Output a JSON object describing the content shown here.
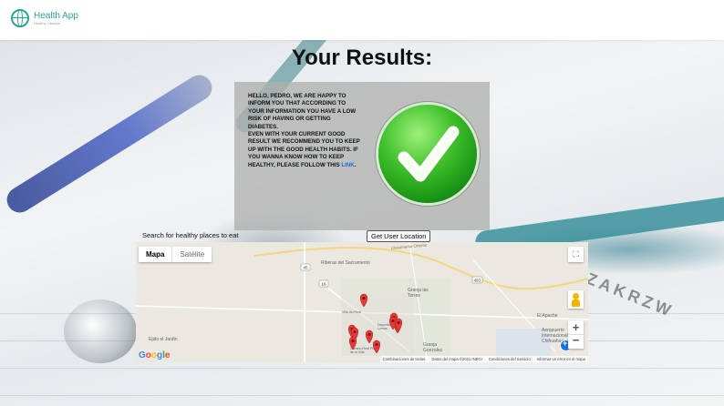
{
  "header": {
    "app_name": "Health App",
    "tagline": "Healthy Lifestyle"
  },
  "page": {
    "title": "Your Results:"
  },
  "result": {
    "message": "Hello, Pedro, we are happy to inform you that according to your information you have a low risk of having or getting diabetes.",
    "advice_prefix": "Even with your current good result we recommend you to keep up with the good health habits. If you wanna know how to keep healthy, please follow this",
    "link_text": "link",
    "advice_suffix": ".",
    "status_icon": "green-check-icon"
  },
  "search": {
    "label": "Search for healthy places to eat",
    "location_button": "Get User Location"
  },
  "map": {
    "type_options": [
      "Mapa",
      "Satélite"
    ],
    "selected_type": "Mapa",
    "places": [
      "Riberas del Sacramento",
      "Granja las Torres",
      "Ejido el Jardín",
      "Granja Gonzalez",
      "El Apache",
      "Aeropuerto Internacional de Chihuahua",
      "Camino Real Pta. de la Villa",
      "Villa del Real",
      "Deportivo Lomas"
    ],
    "road_label": "Libramiento Oriente",
    "route_markers": [
      "45",
      "16",
      "45D"
    ],
    "markers_count": 10,
    "attribution": [
      "Combinaciones de teclas",
      "Datos del mapa ©2021 INEGI",
      "Condiciones del Servicio",
      "Informar un error en el mapa"
    ],
    "google_letters": [
      "G",
      "o",
      "o",
      "g",
      "l",
      "e"
    ],
    "fullscreen_icon": "fullscreen-icon",
    "pegman_icon": "pegman-icon",
    "zoom_in": "+",
    "zoom_out": "−"
  },
  "colors": {
    "brand": "#2aa59a",
    "link": "#1a6fd6",
    "marker": "#e53935"
  }
}
